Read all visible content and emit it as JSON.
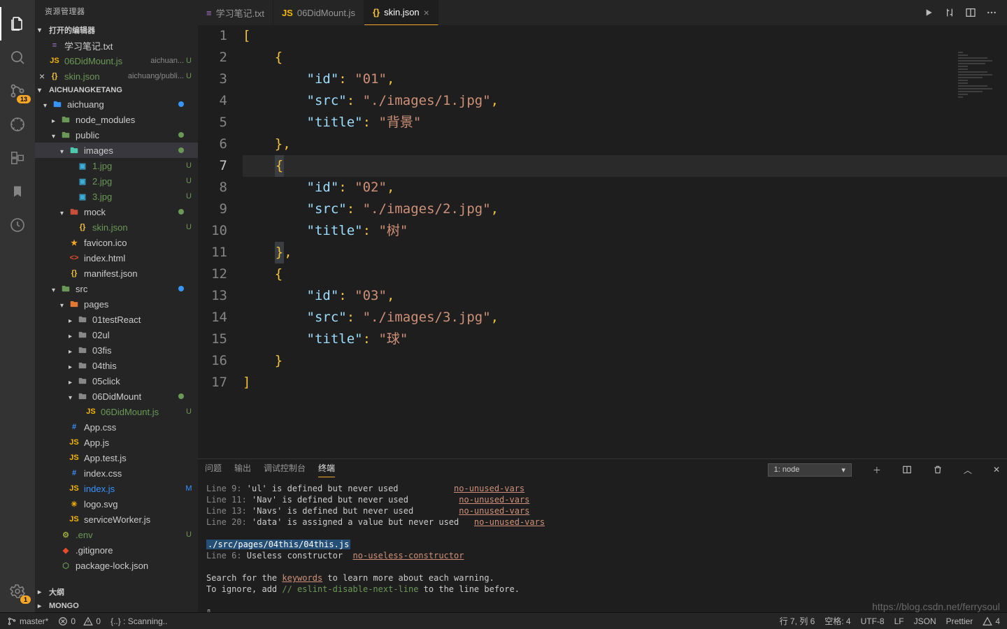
{
  "sidebar": {
    "title": "资源管理器",
    "openEditors": "打开的编辑器",
    "project": "AICHUANGKETANG",
    "outline": "大纲",
    "mongo": "MONGO",
    "badge": "13",
    "settingsBadge": "1",
    "editors": [
      {
        "icon": "txt",
        "label": "学习笔记.txt",
        "hint": "",
        "status": ""
      },
      {
        "icon": "js",
        "label": "06DidMount.js",
        "hint": "aichuan...",
        "status": "U"
      },
      {
        "icon": "json",
        "label": "skin.json",
        "hint": "aichuang/publi...",
        "status": "U",
        "close": true
      }
    ],
    "tree": [
      {
        "d": 0,
        "chev": "d",
        "ic": "folder-blue",
        "lbl": "aichuang",
        "dot": "#3794ff"
      },
      {
        "d": 1,
        "chev": "r",
        "ic": "folder-green",
        "lbl": "node_modules"
      },
      {
        "d": 1,
        "chev": "d",
        "ic": "folder-green",
        "lbl": "public",
        "dot": "#6a9955"
      },
      {
        "d": 2,
        "chev": "d",
        "ic": "folder-teal",
        "lbl": "images",
        "dot": "#6a9955",
        "sel": true
      },
      {
        "d": 3,
        "ic": "img",
        "lbl": "1.jpg",
        "stat": "U"
      },
      {
        "d": 3,
        "ic": "img",
        "lbl": "2.jpg",
        "stat": "U"
      },
      {
        "d": 3,
        "ic": "img",
        "lbl": "3.jpg",
        "stat": "U"
      },
      {
        "d": 2,
        "chev": "d",
        "ic": "folder-red",
        "lbl": "mock",
        "dot": "#6a9955"
      },
      {
        "d": 3,
        "ic": "json",
        "lbl": "skin.json",
        "stat": "U"
      },
      {
        "d": 2,
        "ic": "fav",
        "lbl": "favicon.ico"
      },
      {
        "d": 2,
        "ic": "html",
        "lbl": "index.html"
      },
      {
        "d": 2,
        "ic": "json",
        "lbl": "manifest.json"
      },
      {
        "d": 1,
        "chev": "d",
        "ic": "folder-green",
        "lbl": "src",
        "dot": "#3794ff"
      },
      {
        "d": 2,
        "chev": "d",
        "ic": "folder-orange",
        "lbl": "pages"
      },
      {
        "d": 3,
        "chev": "r",
        "ic": "folder-gray",
        "lbl": "01testReact"
      },
      {
        "d": 3,
        "chev": "r",
        "ic": "folder-gray",
        "lbl": "02ul"
      },
      {
        "d": 3,
        "chev": "r",
        "ic": "folder-gray",
        "lbl": "03fis"
      },
      {
        "d": 3,
        "chev": "r",
        "ic": "folder-gray",
        "lbl": "04this"
      },
      {
        "d": 3,
        "chev": "r",
        "ic": "folder-gray",
        "lbl": "05click"
      },
      {
        "d": 3,
        "chev": "d",
        "ic": "folder-gray",
        "lbl": "06DidMount",
        "dot": "#6a9955"
      },
      {
        "d": 4,
        "ic": "js",
        "lbl": "06DidMount.js",
        "stat": "U"
      },
      {
        "d": 2,
        "ic": "css",
        "lbl": "App.css"
      },
      {
        "d": 2,
        "ic": "js",
        "lbl": "App.js"
      },
      {
        "d": 2,
        "ic": "js",
        "lbl": "App.test.js"
      },
      {
        "d": 2,
        "ic": "css",
        "lbl": "index.css"
      },
      {
        "d": 2,
        "ic": "js",
        "lbl": "index.js",
        "stat": "M"
      },
      {
        "d": 2,
        "ic": "svg",
        "lbl": "logo.svg"
      },
      {
        "d": 2,
        "ic": "js",
        "lbl": "serviceWorker.js"
      },
      {
        "d": 1,
        "ic": "env",
        "lbl": ".env",
        "stat": "U"
      },
      {
        "d": 1,
        "ic": "git",
        "lbl": ".gitignore"
      },
      {
        "d": 1,
        "ic": "npm",
        "lbl": "package-lock.json"
      }
    ]
  },
  "tabs": [
    {
      "icon": "txt",
      "label": "学习笔记.txt"
    },
    {
      "icon": "js",
      "label": "06DidMount.js"
    },
    {
      "icon": "json",
      "label": "skin.json",
      "active": true,
      "close": true
    }
  ],
  "code": {
    "lines": [
      {
        "n": 1,
        "seg": [
          [
            "pn",
            "["
          ]
        ]
      },
      {
        "n": 2,
        "seg": [
          [
            "",
            "    "
          ],
          [
            "pn",
            "{"
          ]
        ]
      },
      {
        "n": 3,
        "seg": [
          [
            "",
            "        "
          ],
          [
            "key",
            "\"id\""
          ],
          [
            "pn",
            ": "
          ],
          [
            "str",
            "\"01\""
          ],
          [
            "pn",
            ","
          ]
        ]
      },
      {
        "n": 4,
        "seg": [
          [
            "",
            "        "
          ],
          [
            "key",
            "\"src\""
          ],
          [
            "pn",
            ": "
          ],
          [
            "str",
            "\"./images/1.jpg\""
          ],
          [
            "pn",
            ","
          ]
        ]
      },
      {
        "n": 5,
        "seg": [
          [
            "",
            "        "
          ],
          [
            "key",
            "\"title\""
          ],
          [
            "pn",
            ": "
          ],
          [
            "str",
            "\"背景\""
          ]
        ]
      },
      {
        "n": 6,
        "seg": [
          [
            "",
            "    "
          ],
          [
            "pn",
            "}"
          ],
          [
            "pn",
            ","
          ]
        ]
      },
      {
        "n": 7,
        "hl": true,
        "seg": [
          [
            "",
            "    "
          ],
          [
            "pn box",
            "{"
          ]
        ]
      },
      {
        "n": 8,
        "seg": [
          [
            "",
            "        "
          ],
          [
            "key",
            "\"id\""
          ],
          [
            "pn",
            ": "
          ],
          [
            "str",
            "\"02\""
          ],
          [
            "pn",
            ","
          ]
        ]
      },
      {
        "n": 9,
        "seg": [
          [
            "",
            "        "
          ],
          [
            "key",
            "\"src\""
          ],
          [
            "pn",
            ": "
          ],
          [
            "str",
            "\"./images/2.jpg\""
          ],
          [
            "pn",
            ","
          ]
        ]
      },
      {
        "n": 10,
        "seg": [
          [
            "",
            "        "
          ],
          [
            "key",
            "\"title\""
          ],
          [
            "pn",
            ": "
          ],
          [
            "str",
            "\"树\""
          ]
        ]
      },
      {
        "n": 11,
        "seg": [
          [
            "",
            "    "
          ],
          [
            "pn box",
            "}"
          ],
          [
            "pn",
            ","
          ]
        ]
      },
      {
        "n": 12,
        "seg": [
          [
            "",
            "    "
          ],
          [
            "pn",
            "{"
          ]
        ]
      },
      {
        "n": 13,
        "seg": [
          [
            "",
            "        "
          ],
          [
            "key",
            "\"id\""
          ],
          [
            "pn",
            ": "
          ],
          [
            "str",
            "\"03\""
          ],
          [
            "pn",
            ","
          ]
        ]
      },
      {
        "n": 14,
        "seg": [
          [
            "",
            "        "
          ],
          [
            "key",
            "\"src\""
          ],
          [
            "pn",
            ": "
          ],
          [
            "str",
            "\"./images/3.jpg\""
          ],
          [
            "pn",
            ","
          ]
        ]
      },
      {
        "n": 15,
        "seg": [
          [
            "",
            "        "
          ],
          [
            "key",
            "\"title\""
          ],
          [
            "pn",
            ": "
          ],
          [
            "str",
            "\"球\""
          ]
        ]
      },
      {
        "n": 16,
        "seg": [
          [
            "",
            "    "
          ],
          [
            "pn",
            "}"
          ]
        ]
      },
      {
        "n": 17,
        "seg": [
          [
            "pn",
            "]"
          ]
        ]
      }
    ]
  },
  "panel": {
    "tabs": [
      "问题",
      "输出",
      "调试控制台",
      "终端"
    ],
    "activeTab": 3,
    "selector": "1: node",
    "lines": [
      {
        "pre": "  Line 9:   ",
        "msg": "'ul' is defined but never used",
        "pad": 10,
        "rule": "no-unused-vars"
      },
      {
        "pre": "  Line 11:  ",
        "msg": "'Nav' is defined but never used",
        "pad": 9,
        "rule": "no-unused-vars"
      },
      {
        "pre": "  Line 13:  ",
        "msg": "'Navs' is defined but never used",
        "pad": 8,
        "rule": "no-unused-vars"
      },
      {
        "pre": "  Line 20:  ",
        "msg": "'data' is assigned a value but never used",
        "pad": 2,
        "rule": "no-unused-vars"
      }
    ],
    "path": "./src/pages/04this/04this.js",
    "l6pre": "  Line 6:  ",
    "l6msg": "Useless constructor",
    "l6rule": "no-useless-constructor",
    "search1a": "Search for the ",
    "search1b": "keywords",
    "search1c": " to learn more about each warning.",
    "search2a": "To ignore, add ",
    "search2b": "// eslint-disable-next-line",
    "search2c": " to the line before.",
    "cursor": "▯"
  },
  "status": {
    "branch": "master*",
    "errors": "0",
    "warnings": "0",
    "scan": "{..} : Scanning..",
    "pos": "行 7, 列 6",
    "spaces": "空格: 4",
    "enc": "UTF-8",
    "eol": "LF",
    "lang": "JSON",
    "prettier": "Prettier",
    "warn4": "4"
  },
  "watermark": "https://blog.csdn.net/ferrysoul"
}
